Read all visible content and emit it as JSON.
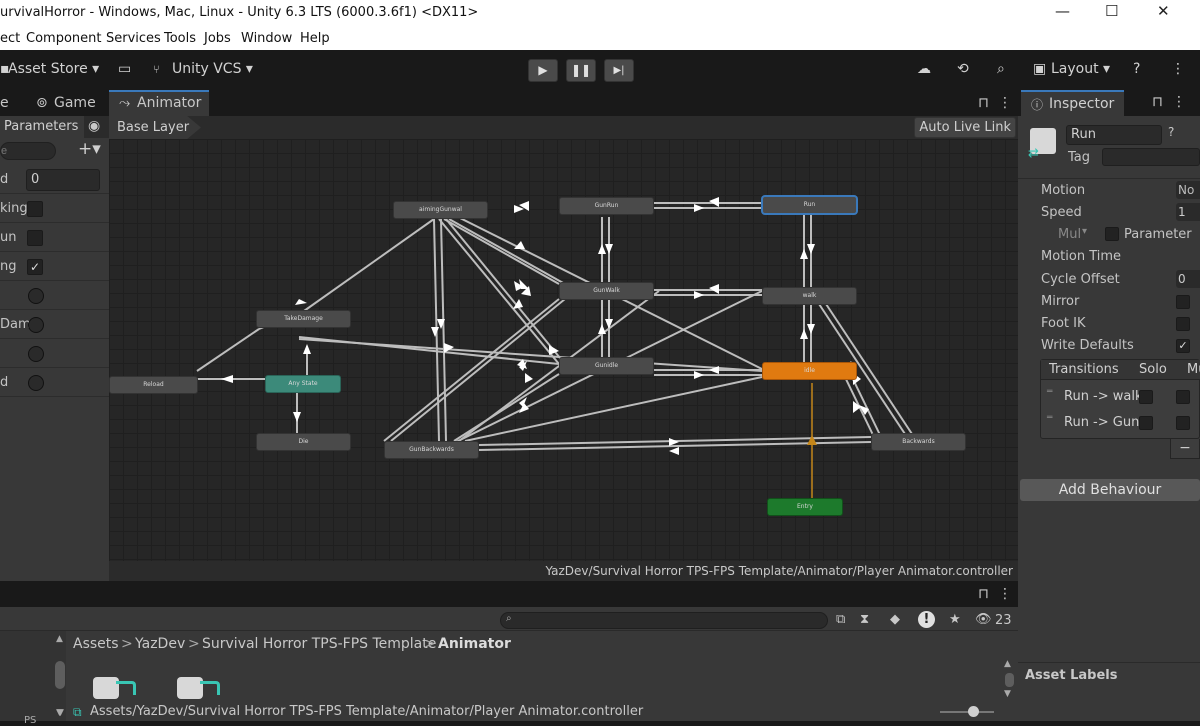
{
  "window": {
    "title": "urvivalHorror - Windows, Mac, Linux - Unity 6.3 LTS (6000.3.6f1) <DX11>",
    "minimize": "—",
    "maximize": "☐",
    "close": "✕"
  },
  "menu": [
    "ect",
    "Component",
    "Services",
    "Tools",
    "Jobs",
    "Window",
    "Help"
  ],
  "toolbar": {
    "asset_store": "Asset Store ▾",
    "unity_vcs": "Unity VCS ▾",
    "layout": "Layout ▾",
    "play": "▶",
    "pause": "❚❚",
    "step": "▶|"
  },
  "tabs": {
    "scene": "e",
    "game": "Game",
    "animator": "Animator",
    "inspector": "Inspector"
  },
  "animator": {
    "params_tab": "Parameters",
    "search_placeholder": "e",
    "base_layer": "Base Layer",
    "auto_live_link": "Auto Live Link",
    "path": "YazDev/Survival Horror TPS-FPS Template/Animator/Player Animator.controller",
    "params": [
      {
        "name": "d",
        "value": "0"
      },
      {
        "name": "king",
        "type": "bool",
        "checked": false
      },
      {
        "name": "un",
        "type": "bool",
        "checked": false
      },
      {
        "name": "ng",
        "type": "bool",
        "checked": true
      },
      {
        "name": "",
        "type": "trigger"
      },
      {
        "name": "Dama",
        "type": "trigger"
      },
      {
        "name": "",
        "type": "trigger"
      },
      {
        "name": "d",
        "type": "trigger"
      }
    ],
    "nodes": {
      "aimingGunwal": "aimingGunwal",
      "GunRun": "GunRun",
      "Run": "Run",
      "GunWalk": "GunWalk",
      "walk": "walk",
      "TakeDamage": "TakeDamage",
      "Gunidle": "Gunidle",
      "idle": "idle",
      "Reload": "Reload",
      "AnyState": "Any State",
      "Die": "Die",
      "GunBackwards": "GunBackwards",
      "Backwards": "Backwards",
      "Entry": "Entry"
    }
  },
  "inspector": {
    "name": "Run",
    "tag_label": "Tag",
    "motion": "Motion",
    "motion_value": "No",
    "speed": "Speed",
    "speed_value": "1",
    "multiplier": "Mul",
    "parameter": "Parameter",
    "motion_time": "Motion Time",
    "cycle_offset": "Cycle Offset",
    "cycle_value": "0",
    "mirror": "Mirror",
    "foot_ik": "Foot IK",
    "write_defaults": "Write Defaults",
    "transitions": "Transitions",
    "solo": "Solo",
    "mute": "Mu",
    "transition_items": [
      "Run -> walk",
      "Run -> Gunl"
    ],
    "remove": "−",
    "add_behaviour": "Add Behaviour",
    "asset_labels": "Asset Labels"
  },
  "project": {
    "breadcrumb": [
      "Assets",
      "YazDev",
      "Survival Horror TPS-FPS Template",
      "Animator"
    ],
    "selected_path": "Assets/YazDev/Survival Horror TPS-FPS Template/Animator/Player Animator.controller",
    "count": "23",
    "left_stub": "PS"
  },
  "colors": {
    "idle_node": "#e07a10",
    "entry_node": "#1d7a2c",
    "anystate_node": "#3c8a7a",
    "selected_border": "#3a79bb"
  }
}
